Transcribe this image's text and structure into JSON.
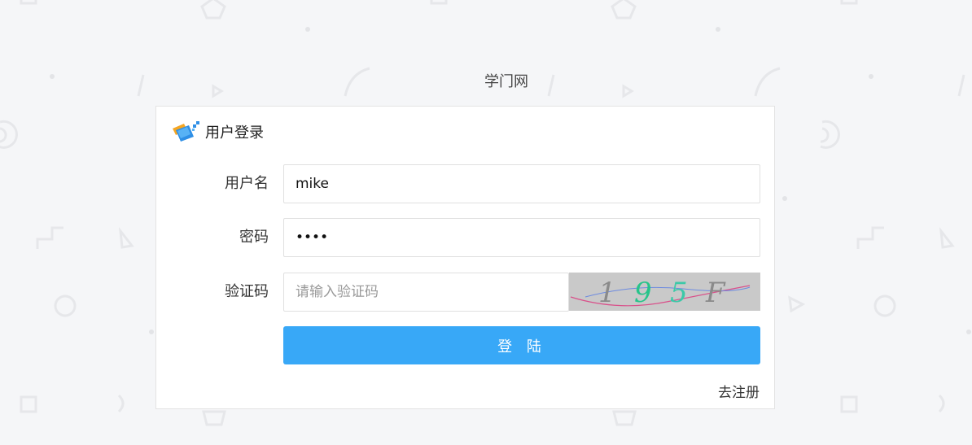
{
  "site": {
    "title": "学门网"
  },
  "login_card": {
    "title": "用户登录",
    "logo_icon": "colorful-box-icon"
  },
  "form": {
    "username": {
      "label": "用户名",
      "value": "mike",
      "placeholder": ""
    },
    "password": {
      "label": "密码",
      "value": "abcd",
      "placeholder": ""
    },
    "captcha": {
      "label": "验证码",
      "value": "",
      "placeholder": "请输入验证码",
      "image_text": "195F"
    },
    "submit_label": "登 陆",
    "register_link": "去注册"
  },
  "colors": {
    "primary": "#38a8f7",
    "background": "#f5f6f8",
    "card": "#ffffff"
  }
}
